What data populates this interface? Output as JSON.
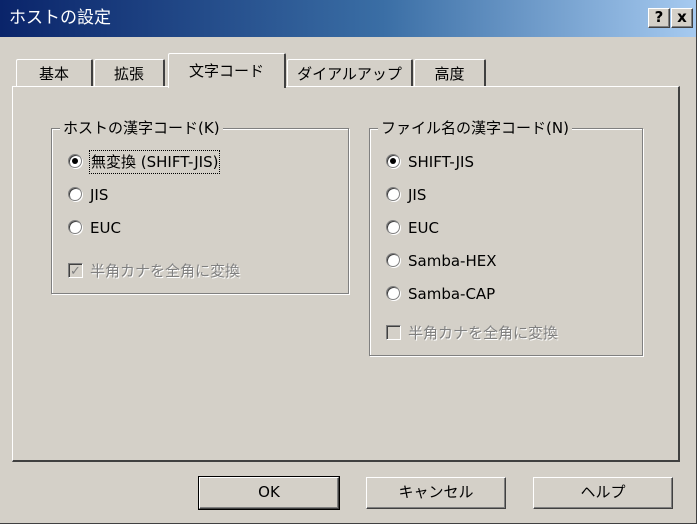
{
  "window": {
    "title": "ホストの設定",
    "help_glyph": "?",
    "close_glyph": "x"
  },
  "tabs": [
    {
      "label": "基本",
      "active": false
    },
    {
      "label": "拡張",
      "active": false
    },
    {
      "label": "文字コード",
      "active": true
    },
    {
      "label": "ダイアルアップ",
      "active": false
    },
    {
      "label": "高度",
      "active": false
    }
  ],
  "host_group": {
    "label": "ホストの漢字コード(K)",
    "options": [
      {
        "label": "無変換 (SHIFT-JIS)",
        "checked": true
      },
      {
        "label": "JIS",
        "checked": false
      },
      {
        "label": "EUC",
        "checked": false
      }
    ],
    "checkbox": {
      "label": "半角カナを全角に変換",
      "checked": true,
      "enabled": false
    }
  },
  "filename_group": {
    "label": "ファイル名の漢字コード(N)",
    "options": [
      {
        "label": "SHIFT-JIS",
        "checked": true
      },
      {
        "label": "JIS",
        "checked": false
      },
      {
        "label": "EUC",
        "checked": false
      },
      {
        "label": "Samba-HEX",
        "checked": false
      },
      {
        "label": "Samba-CAP",
        "checked": false
      }
    ],
    "checkbox": {
      "label": "半角カナを全角に変換",
      "checked": false,
      "enabled": false
    }
  },
  "buttons": {
    "ok": "OK",
    "cancel": "キャンセル",
    "help": "ヘルプ"
  }
}
